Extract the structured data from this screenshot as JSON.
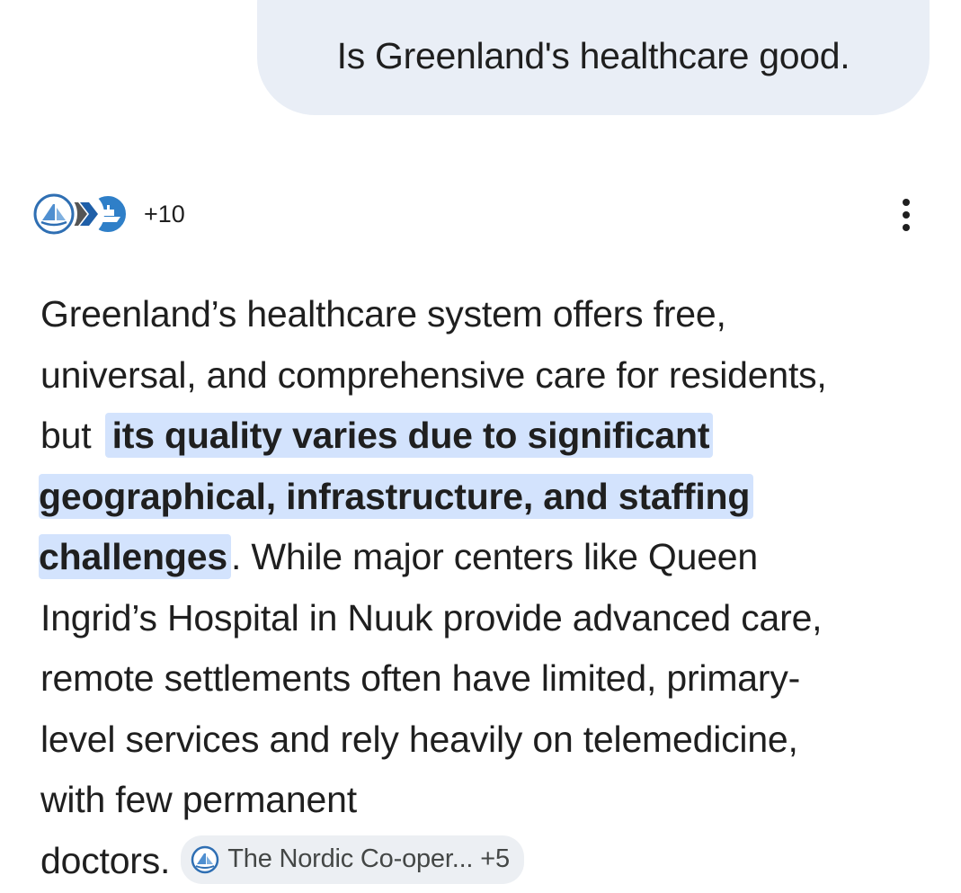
{
  "user_message": "Is Greenland's healthcare good.",
  "sources": {
    "icons": [
      "nordic-cooperation-icon",
      "chevron-logo-icon",
      "ship-logo-icon"
    ],
    "more_count": "+10"
  },
  "answer": {
    "line1": "Greenland’s healthcare system offers free,",
    "line2": "universal, and comprehensive care for residents,",
    "line3_plain": "but ",
    "line3_hl": "its quality varies due to significant",
    "line4_hl": "geographical, infrastructure, and staffing",
    "line5_hl": "challenges",
    "line5_plain": ". While major centers like Queen",
    "line6": "Ingrid’s Hospital in Nuuk provide advanced care,",
    "line7": "remote settlements often have limited, primary-",
    "line8": "level services and rely heavily on telemedicine,",
    "line9": "with few permanent",
    "line10_plain": "doctors."
  },
  "source_chip": {
    "label": "The Nordic Co-oper...",
    "count": "+5",
    "icon": "nordic-cooperation-icon"
  },
  "colors": {
    "user_bubble": "#e9eef6",
    "highlight": "#d3e3fd",
    "chip_bg": "#eceff3",
    "brand_blue": "#2f6fb3"
  }
}
